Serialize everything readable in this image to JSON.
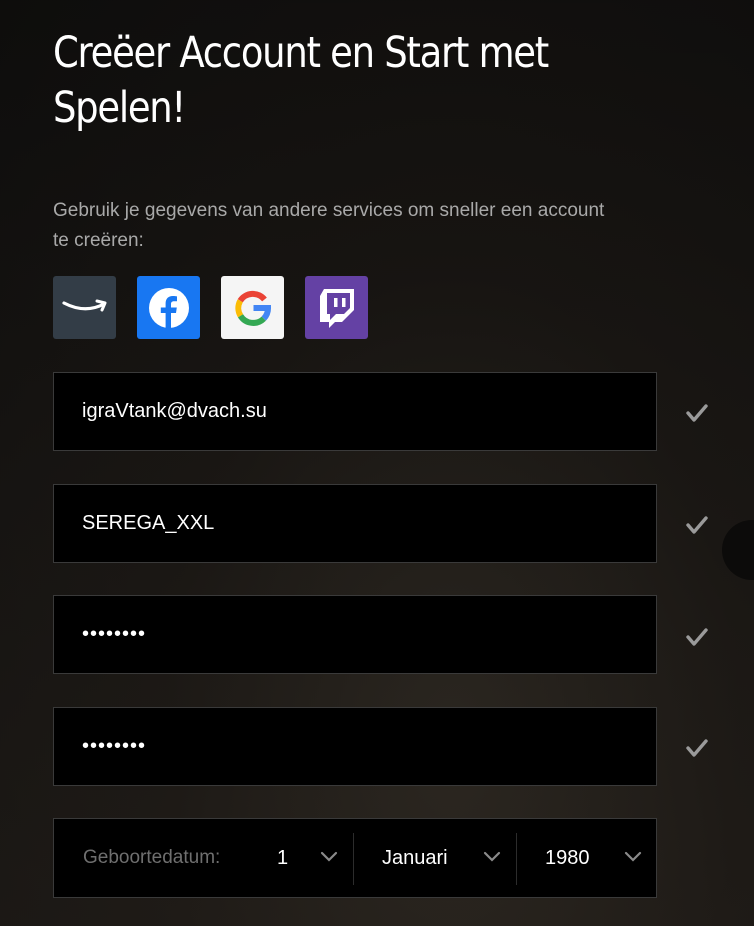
{
  "header": {
    "title": "Creëer Account en Start met Spelen!"
  },
  "intro": {
    "text": "Gebruik je gegevens van andere services om sneller een account te creëren:"
  },
  "socials": [
    {
      "name": "amazon-icon",
      "color": "#333d47"
    },
    {
      "name": "facebook-icon",
      "color": "#1877f2"
    },
    {
      "name": "google-icon",
      "color": "#f5f5f5"
    },
    {
      "name": "twitch-icon",
      "color": "#6441a4"
    }
  ],
  "form": {
    "email": {
      "value": "igraVtank@dvach.su"
    },
    "username": {
      "value": "SEREGA_XXL"
    },
    "password": {
      "masked": "••••••••"
    },
    "password_confirm": {
      "masked": "••••••••"
    },
    "birthdate": {
      "label": "Geboortedatum:",
      "day": "1",
      "month": "Januari",
      "year": "1980"
    }
  },
  "colors": {
    "check": "#9a9a9a",
    "field_border": "#3a3a3a"
  }
}
